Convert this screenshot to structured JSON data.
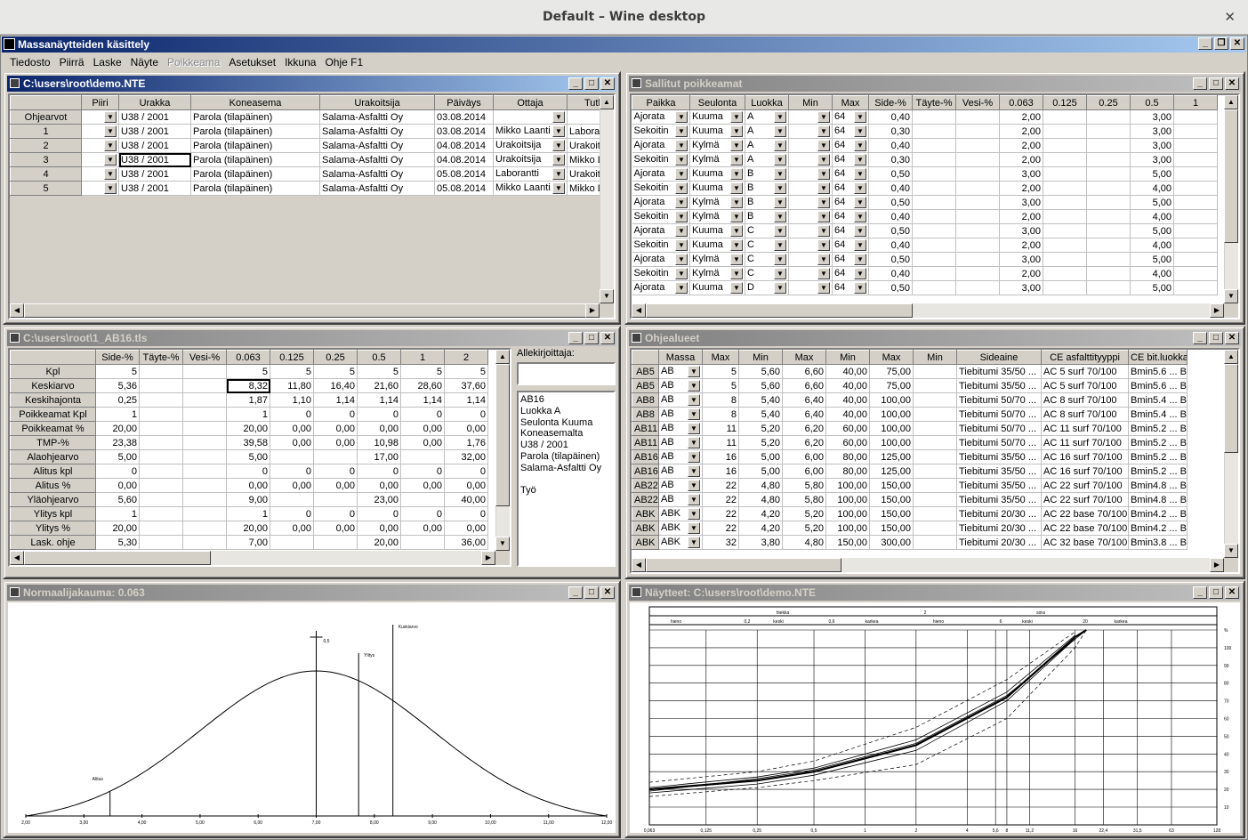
{
  "wm_title": "Default – Wine desktop",
  "app_title": "Massanäytteiden käsittely",
  "menu": [
    {
      "label": "Tiedosto",
      "disabled": false
    },
    {
      "label": "Piirrä",
      "disabled": false
    },
    {
      "label": "Laske",
      "disabled": false
    },
    {
      "label": "Näyte",
      "disabled": false
    },
    {
      "label": "Poikkeama",
      "disabled": true
    },
    {
      "label": "Asetukset",
      "disabled": false
    },
    {
      "label": "Ikkuna",
      "disabled": false
    },
    {
      "label": "Ohje F1",
      "disabled": false
    }
  ],
  "w1": {
    "title": "C:\\users\\root\\demo.NTE",
    "headers": [
      "",
      "Piiri",
      "Urakka",
      "Koneasema",
      "Urakoitsija",
      "Päiväys",
      "Ottaja",
      "Tutk"
    ],
    "rows": [
      [
        "Ohjearvot",
        "",
        "U38 / 2001",
        "Parola (tilapäinen)",
        "Salama-Asfaltti Oy",
        "03.08.2014",
        "",
        ""
      ],
      [
        "1",
        "",
        "U38 / 2001",
        "Parola (tilapäinen)",
        "Salama-Asfaltti Oy",
        "03.08.2014",
        "Mikko Laanti",
        "Laboran"
      ],
      [
        "2",
        "",
        "U38 / 2001",
        "Parola (tilapäinen)",
        "Salama-Asfaltti Oy",
        "04.08.2014",
        "Urakoitsija",
        "Urakoits"
      ],
      [
        "3",
        "",
        "U38 / 2001",
        "Parola (tilapäinen)",
        "Salama-Asfaltti Oy",
        "04.08.2014",
        "Urakoitsija",
        "Mikko La"
      ],
      [
        "4",
        "",
        "U38 / 2001",
        "Parola (tilapäinen)",
        "Salama-Asfaltti Oy",
        "05.08.2014",
        "Laborantti",
        "Urakoits"
      ],
      [
        "5",
        "",
        "U38 / 2001",
        "Parola (tilapäinen)",
        "Salama-Asfaltti Oy",
        "05.08.2014",
        "Mikko Laanti",
        "Mikko La"
      ]
    ]
  },
  "w2": {
    "title": "Sallitut poikkeamat",
    "headers": [
      "Paikka",
      "Seulonta",
      "Luokka",
      "Min",
      "Max",
      "Side-%",
      "Täyte-%",
      "Vesi-%",
      "0.063",
      "0.125",
      "0.25",
      "0.5",
      "1"
    ],
    "rows": [
      [
        "Ajorata",
        "Kuuma",
        "A",
        "",
        "64",
        "0,40",
        "",
        "",
        "2,00",
        "",
        "",
        "3,00",
        ""
      ],
      [
        "Sekoitin",
        "Kuuma",
        "A",
        "",
        "64",
        "0,30",
        "",
        "",
        "2,00",
        "",
        "",
        "3,00",
        ""
      ],
      [
        "Ajorata",
        "Kylmä",
        "A",
        "",
        "64",
        "0,40",
        "",
        "",
        "2,00",
        "",
        "",
        "3,00",
        ""
      ],
      [
        "Sekoitin",
        "Kylmä",
        "A",
        "",
        "64",
        "0,30",
        "",
        "",
        "2,00",
        "",
        "",
        "3,00",
        ""
      ],
      [
        "Ajorata",
        "Kuuma",
        "B",
        "",
        "64",
        "0,50",
        "",
        "",
        "3,00",
        "",
        "",
        "5,00",
        ""
      ],
      [
        "Sekoitin",
        "Kuuma",
        "B",
        "",
        "64",
        "0,40",
        "",
        "",
        "2,00",
        "",
        "",
        "4,00",
        ""
      ],
      [
        "Ajorata",
        "Kylmä",
        "B",
        "",
        "64",
        "0,50",
        "",
        "",
        "3,00",
        "",
        "",
        "5,00",
        ""
      ],
      [
        "Sekoitin",
        "Kylmä",
        "B",
        "",
        "64",
        "0,40",
        "",
        "",
        "2,00",
        "",
        "",
        "4,00",
        ""
      ],
      [
        "Ajorata",
        "Kuuma",
        "C",
        "",
        "64",
        "0,50",
        "",
        "",
        "3,00",
        "",
        "",
        "5,00",
        ""
      ],
      [
        "Sekoitin",
        "Kuuma",
        "C",
        "",
        "64",
        "0,40",
        "",
        "",
        "2,00",
        "",
        "",
        "4,00",
        ""
      ],
      [
        "Ajorata",
        "Kylmä",
        "C",
        "",
        "64",
        "0,50",
        "",
        "",
        "3,00",
        "",
        "",
        "5,00",
        ""
      ],
      [
        "Sekoitin",
        "Kylmä",
        "C",
        "",
        "64",
        "0,40",
        "",
        "",
        "2,00",
        "",
        "",
        "4,00",
        ""
      ],
      [
        "Ajorata",
        "Kuuma",
        "D",
        "",
        "64",
        "0,50",
        "",
        "",
        "3,00",
        "",
        "",
        "5,00",
        ""
      ]
    ]
  },
  "w3": {
    "title": "C:\\users\\root\\1_AB16.tls",
    "headers": [
      "",
      "Side-%",
      "Täyte-%",
      "Vesi-%",
      "0.063",
      "0.125",
      "0.25",
      "0.5",
      "1",
      "2"
    ],
    "rows": [
      [
        "Kpl",
        "5",
        "",
        "",
        "5",
        "5",
        "5",
        "5",
        "5",
        "5"
      ],
      [
        "Keskiarvo",
        "5,36",
        "",
        "",
        "8,32",
        "11,80",
        "16,40",
        "21,60",
        "28,60",
        "37,60"
      ],
      [
        "Keskihajonta",
        "0,25",
        "",
        "",
        "1,87",
        "1,10",
        "1,14",
        "1,14",
        "1,14",
        "1,14"
      ],
      [
        "Poikkeamat Kpl",
        "1",
        "",
        "",
        "1",
        "0",
        "0",
        "0",
        "0",
        "0"
      ],
      [
        "Poikkeamat %",
        "20,00",
        "",
        "",
        "20,00",
        "0,00",
        "0,00",
        "0,00",
        "0,00",
        "0,00"
      ],
      [
        "TMP-%",
        "23,38",
        "",
        "",
        "39,58",
        "0,00",
        "0,00",
        "10,98",
        "0,00",
        "1,76"
      ],
      [
        "Alaohjearvo",
        "5,00",
        "",
        "",
        "5,00",
        "",
        "",
        "17,00",
        "",
        "32,00"
      ],
      [
        "Alitus kpl",
        "0",
        "",
        "",
        "0",
        "0",
        "0",
        "0",
        "0",
        "0"
      ],
      [
        "Alitus %",
        "0,00",
        "",
        "",
        "0,00",
        "0,00",
        "0,00",
        "0,00",
        "0,00",
        "0,00"
      ],
      [
        "Yläohjearvo",
        "5,60",
        "",
        "",
        "9,00",
        "",
        "",
        "23,00",
        "",
        "40,00"
      ],
      [
        "Ylitys kpl",
        "1",
        "",
        "",
        "1",
        "0",
        "0",
        "0",
        "0",
        "0"
      ],
      [
        "Ylitys %",
        "20,00",
        "",
        "",
        "20,00",
        "0,00",
        "0,00",
        "0,00",
        "0,00",
        "0,00"
      ],
      [
        "Lask. ohje",
        "5,30",
        "",
        "",
        "7,00",
        "",
        "",
        "20,00",
        "",
        "36,00"
      ]
    ],
    "signer_label": "Allekirjoittaja:",
    "info_lines": [
      "AB16",
      "Luokka A",
      "Seulonta Kuuma",
      "Koneasemalta",
      "U38 / 2001",
      "Parola (tilapäinen)",
      "Salama-Asfaltti Oy",
      "",
      "Työ"
    ]
  },
  "w4": {
    "title": "Ohjealueet",
    "headers": [
      "",
      "Massa",
      "Max",
      "Min",
      "Max",
      "Min",
      "Max",
      "Min",
      "Sideaine",
      "CE asfalttityyppi",
      "CE bit.luokka"
    ],
    "rows": [
      [
        "AB5",
        "AB",
        "5",
        "5,60",
        "6,60",
        "40,00",
        "75,00",
        "",
        "Tiebitumi 35/50 ...",
        "AC 5 surf 70/100",
        "Bmin5.6 ... Bmin6.6"
      ],
      [
        "AB5",
        "AB",
        "5",
        "5,60",
        "6,60",
        "40,00",
        "75,00",
        "",
        "Tiebitumi 35/50 ...",
        "AC 5 surf 70/100",
        "Bmin5.6 ... Bmin6.6"
      ],
      [
        "AB8",
        "AB",
        "8",
        "5,40",
        "6,40",
        "40,00",
        "100,00",
        "",
        "Tiebitumi 50/70 ...",
        "AC 8 surf 70/100",
        "Bmin5.4 ... Bmin6.4"
      ],
      [
        "AB8",
        "AB",
        "8",
        "5,40",
        "6,40",
        "40,00",
        "100,00",
        "",
        "Tiebitumi 50/70 ...",
        "AC 8 surf 70/100",
        "Bmin5.4 ... Bmin6.4"
      ],
      [
        "AB11",
        "AB",
        "11",
        "5,20",
        "6,20",
        "60,00",
        "100,00",
        "",
        "Tiebitumi 50/70 ...",
        "AC 11 surf 70/100",
        "Bmin5.2 ... Bmin6.2"
      ],
      [
        "AB11",
        "AB",
        "11",
        "5,20",
        "6,20",
        "60,00",
        "100,00",
        "",
        "Tiebitumi 50/70 ...",
        "AC 11 surf 70/100",
        "Bmin5.2 ... Bmin6.2"
      ],
      [
        "AB16",
        "AB",
        "16",
        "5,00",
        "6,00",
        "80,00",
        "125,00",
        "",
        "Tiebitumi 35/50 ...",
        "AC 16 surf 70/100",
        "Bmin5.2 ... Bmin6.2"
      ],
      [
        "AB16",
        "AB",
        "16",
        "5,00",
        "6,00",
        "80,00",
        "125,00",
        "",
        "Tiebitumi 35/50 ...",
        "AC 16 surf 70/100",
        "Bmin5.2 ... Bmin6.2"
      ],
      [
        "AB22",
        "AB",
        "22",
        "4,80",
        "5,80",
        "100,00",
        "150,00",
        "",
        "Tiebitumi 35/50 ...",
        "AC 22 surf 70/100",
        "Bmin4.8 ... Bmin5.8"
      ],
      [
        "AB22",
        "AB",
        "22",
        "4,80",
        "5,80",
        "100,00",
        "150,00",
        "",
        "Tiebitumi 35/50 ...",
        "AC 22 surf 70/100",
        "Bmin4.8 ... Bmin5.8"
      ],
      [
        "ABK",
        "ABK",
        "22",
        "4,20",
        "5,20",
        "100,00",
        "150,00",
        "",
        "Tiebitumi 20/30 ...",
        "AC 22 base 70/100",
        "Bmin4.2 ... Bmin5.2"
      ],
      [
        "ABK",
        "ABK",
        "22",
        "4,20",
        "5,20",
        "100,00",
        "150,00",
        "",
        "Tiebitumi 20/30 ...",
        "AC 22 base 70/100",
        "Bmin4.2 ... Bmin5.2"
      ],
      [
        "ABK",
        "ABK",
        "32",
        "3,80",
        "4,80",
        "150,00",
        "300,00",
        "",
        "Tiebitumi 20/30 ...",
        "AC 32 base 70/100",
        "Bmin3.8 ... Bmin4.8"
      ]
    ]
  },
  "w5": {
    "title": "Normaalijakauma: 0.063",
    "chart_data": {
      "type": "line",
      "mean": 7.0,
      "x_ticks": [
        "2,00",
        "3,00",
        "4,00",
        "5,00",
        "6,00",
        "7,00",
        "8,00",
        "9,00",
        "10,00",
        "11,00",
        "12,00"
      ],
      "xlim": [
        2,
        12
      ],
      "markers": [
        {
          "label": "Alitus",
          "x": 3.45
        },
        {
          "label": "Ylitys",
          "x": 7.73
        },
        {
          "label": "Kuskiarvo",
          "x": 8.32
        }
      ],
      "mean_label": "0,5"
    }
  },
  "w6": {
    "title": "Näytteet: C:\\users\\root\\demo.NTE",
    "chart_data": {
      "type": "line",
      "x_ticks": [
        "0,063",
        "0,125",
        "0,25",
        "0,5",
        "1",
        "2",
        "4",
        "5,6",
        "8",
        "11,2",
        "16",
        "22,4",
        "31,5",
        "63",
        "128"
      ],
      "y_ticks": [
        "%",
        "100",
        "90",
        "80",
        "70",
        "60",
        "50",
        "40",
        "30",
        "20",
        "10"
      ],
      "header_row1": [
        "hiekka",
        "2",
        "sora"
      ],
      "header_row2": [
        "hieno",
        "0,2",
        "keski",
        "0,6",
        "karkea",
        "hieno",
        "6",
        "keski",
        "20",
        "karkea"
      ]
    }
  }
}
